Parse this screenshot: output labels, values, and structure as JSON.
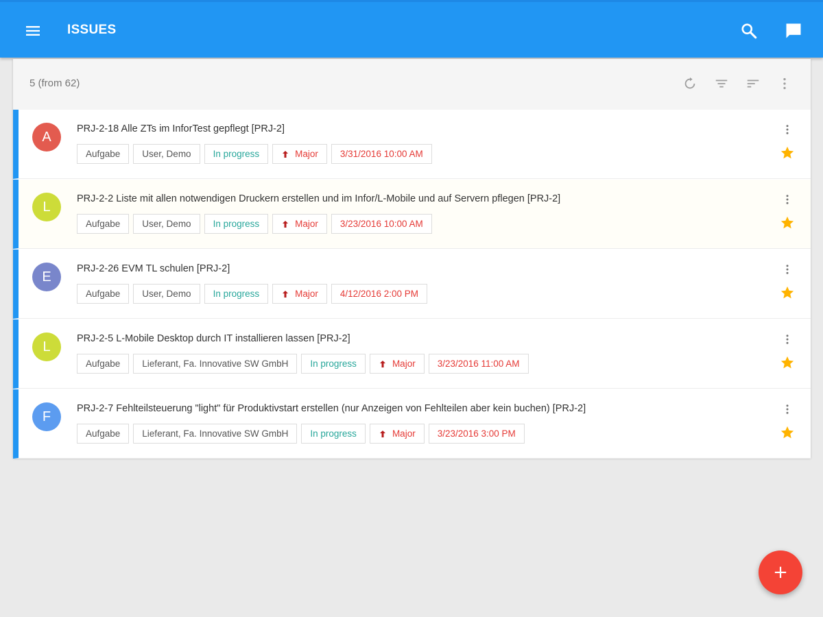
{
  "appbar": {
    "title": "ISSUES",
    "menu_icon": "menu-icon",
    "search_icon": "search-icon",
    "chat_icon": "chat-icon",
    "color": "#2196f3"
  },
  "toolbar": {
    "count_label": "5 (from 62)",
    "icons": [
      "refresh-icon",
      "filter-icon",
      "sort-icon",
      "more-vert-icon"
    ]
  },
  "issues": [
    {
      "initial": "A",
      "avatar_color": "#e35b4f",
      "title": "PRJ-2-18 Alle ZTs im InforTest gepflegt [PRJ-2]",
      "type": "Aufgabe",
      "assignee": "User, Demo",
      "status": "In progress",
      "priority": "Major",
      "date": "3/31/2016 10:00 AM",
      "starred": true
    },
    {
      "initial": "L",
      "avatar_color": "#cddc39",
      "title": "PRJ-2-2 Liste mit allen notwendigen Druckern erstellen und im Infor/L-Mobile und auf Servern pflegen [PRJ-2]",
      "type": "Aufgabe",
      "assignee": "User, Demo",
      "status": "In progress",
      "priority": "Major",
      "date": "3/23/2016 10:00 AM",
      "starred": true
    },
    {
      "initial": "E",
      "avatar_color": "#7986cb",
      "title": "PRJ-2-26 EVM TL schulen [PRJ-2]",
      "type": "Aufgabe",
      "assignee": "User, Demo",
      "status": "In progress",
      "priority": "Major",
      "date": "4/12/2016 2:00 PM",
      "starred": true
    },
    {
      "initial": "L",
      "avatar_color": "#cddc39",
      "title": "PRJ-2-5 L-Mobile Desktop durch IT installieren lassen [PRJ-2]",
      "type": "Aufgabe",
      "assignee": "Lieferant, Fa. Innovative SW GmbH",
      "status": "In progress",
      "priority": "Major",
      "date": "3/23/2016 11:00 AM",
      "starred": true
    },
    {
      "initial": "F",
      "avatar_color": "#5c9cf0",
      "title": "PRJ-2-7 Fehlteilsteuerung \"light\" für Produktivstart erstellen (nur Anzeigen von Fehlteilen aber kein buchen) [PRJ-2]",
      "type": "Aufgabe",
      "assignee": "Lieferant, Fa. Innovative SW GmbH",
      "status": "In progress",
      "priority": "Major",
      "date": "3/23/2016 3:00 PM",
      "starred": true
    }
  ],
  "fab": {
    "label": "+",
    "color": "#f44336"
  },
  "colors": {
    "accent": "#2196f3",
    "status": "#26a69a",
    "priority": "#e53935",
    "star": "#ffb300"
  }
}
